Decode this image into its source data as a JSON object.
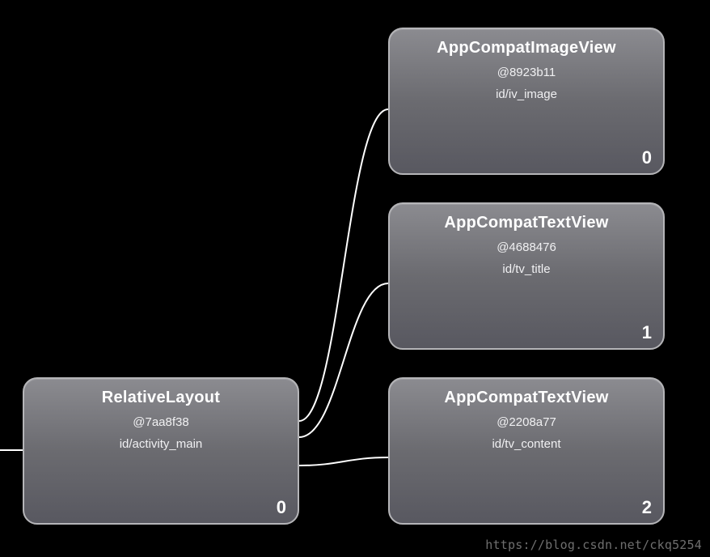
{
  "root": {
    "title": "RelativeLayout",
    "hash": "@7aa8f38",
    "id_line": "id/activity_main",
    "index": "0"
  },
  "children": [
    {
      "title": "AppCompatImageView",
      "hash": "@8923b11",
      "id_line": "id/iv_image",
      "index": "0"
    },
    {
      "title": "AppCompatTextView",
      "hash": "@4688476",
      "id_line": "id/tv_title",
      "index": "1"
    },
    {
      "title": "AppCompatTextView",
      "hash": "@2208a77",
      "id_line": "id/tv_content",
      "index": "2"
    }
  ],
  "watermark": "https://blog.csdn.net/ckq5254"
}
